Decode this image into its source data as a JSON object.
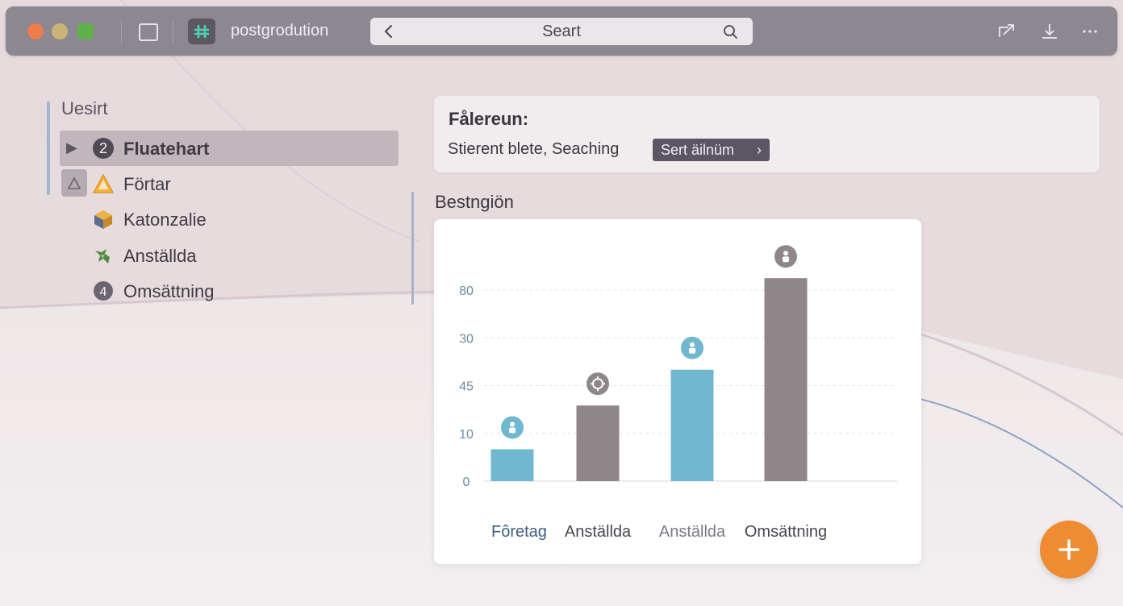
{
  "window": {
    "app_name": "postgrodution",
    "search_value": "Seart"
  },
  "icons": {
    "back": "chevron-left-icon",
    "search": "search-icon",
    "share": "share-icon",
    "download": "download-icon",
    "more": "more-icon"
  },
  "sidebar": {
    "title": "Uesirt",
    "items": [
      {
        "label": "Fluatehart",
        "badge": "2",
        "icon": "number-badge-icon",
        "selected": true
      },
      {
        "label": "Förtar",
        "icon": "warning-icon",
        "selected": false
      },
      {
        "label": "Katonzalie",
        "icon": "box-icon",
        "selected": false
      },
      {
        "label": "Anställda",
        "icon": "people-icon",
        "selected": false
      },
      {
        "label": "Omsättning",
        "badge": "4",
        "icon": "number-badge-icon",
        "selected": false
      }
    ]
  },
  "info": {
    "title": "Fålereun:",
    "text": "Stierent blete, Seaching",
    "button_label": "Sert äilnüm",
    "button_chevron": "›"
  },
  "section": {
    "title": "Bestngiön"
  },
  "chart_data": {
    "type": "bar",
    "categories": [
      "Fôretag",
      "Anställda",
      "Anställda",
      "Omsättning"
    ],
    "values": [
      8,
      19,
      28,
      51
    ],
    "colors": [
      "#6fb8cf",
      "#8f8689",
      "#6fb8cf",
      "#8f8689"
    ],
    "marker_icons": [
      "person-icon",
      "gear-icon",
      "person-icon",
      "person-icon"
    ],
    "ytick_values": [
      0,
      12,
      24,
      36,
      48
    ],
    "ytick_labels": [
      "0",
      "10",
      "45",
      "30",
      "80"
    ],
    "ylim": [
      0,
      48
    ],
    "grid": true,
    "category_colors": [
      "#3d5f7e",
      "#4a4450",
      "#7d7883",
      "#4a4450"
    ]
  },
  "colors": {
    "accent": "#ef8c33",
    "bar_blue": "#6fb8cf",
    "bar_gray": "#8f8689"
  }
}
